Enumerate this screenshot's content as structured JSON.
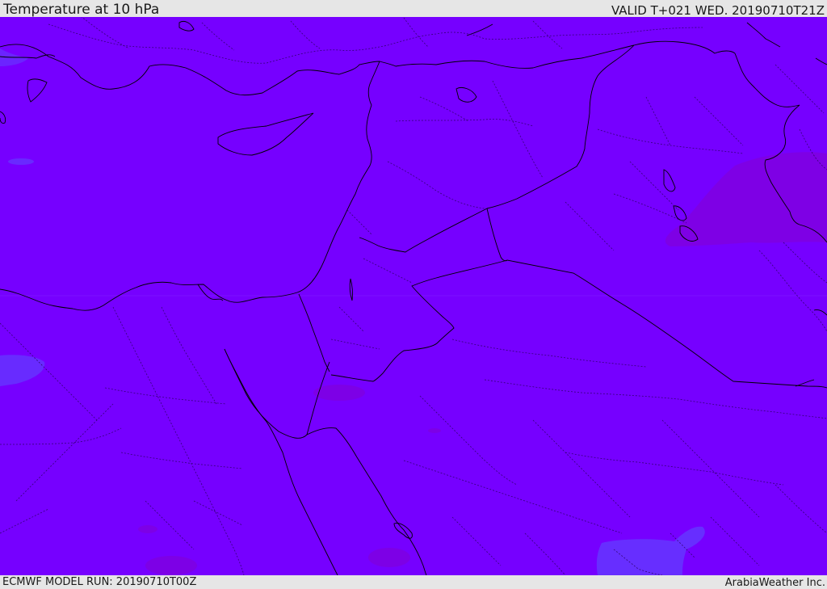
{
  "header": {
    "title": "Temperature at 10 hPa",
    "valid": "VALID T+021 WED. 20190710T21Z"
  },
  "footer": {
    "run": "ECMWF MODEL RUN: 20190710T00Z",
    "credit": "ArabiaWeather Inc."
  },
  "map": {
    "field_color": "#7600ff",
    "warm_patch_color": "#7d00e6",
    "cool_patch_color": "#6633ff",
    "coastline_color": "#000000",
    "border_style": "dotted"
  }
}
